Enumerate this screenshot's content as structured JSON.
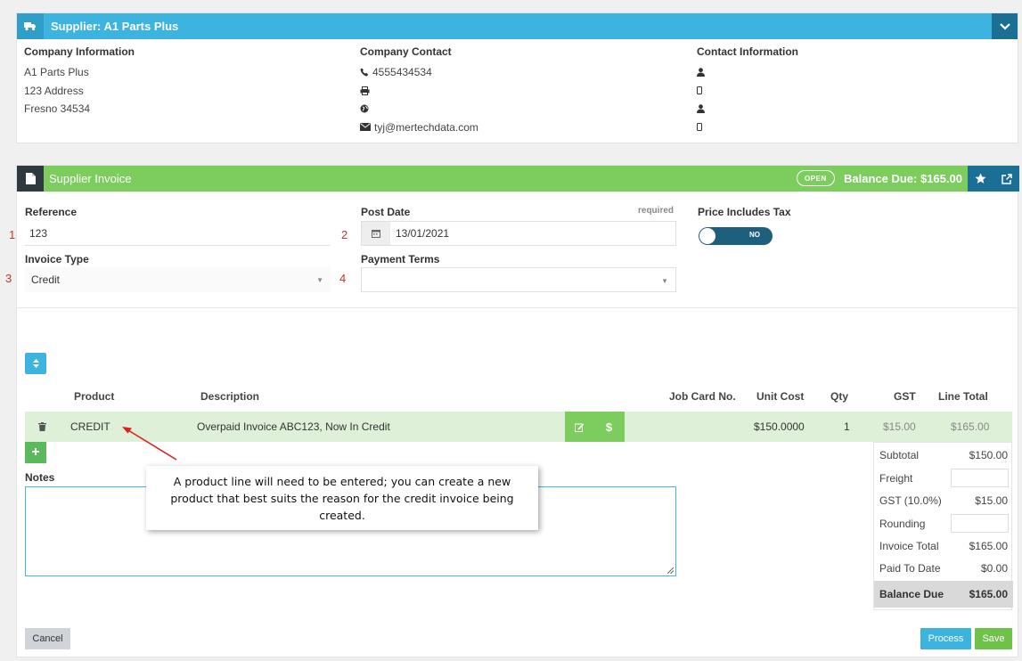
{
  "supplier": {
    "title": "Supplier: A1 Parts Plus",
    "company_info": {
      "heading": "Company Information",
      "lines": [
        "A1 Parts Plus",
        "123 Address",
        "Fresno 34534"
      ]
    },
    "company_contact": {
      "heading": "Company Contact",
      "phone": "4555434534",
      "fax": "",
      "web": "",
      "email": "tyj@mertechdata.com"
    },
    "contact_info": {
      "heading": "Contact Information"
    }
  },
  "invoice": {
    "title": "Supplier Invoice",
    "status_badge": "OPEN",
    "balance_due_header": "Balance Due: $165.00",
    "fields": {
      "reference_label": "Reference",
      "reference_value": "123",
      "post_date_label": "Post Date",
      "post_date_required": "required",
      "post_date_value": "13/01/2021",
      "price_tax_label": "Price Includes Tax",
      "price_tax_toggle": "NO",
      "invoice_type_label": "Invoice Type",
      "invoice_type_value": "Credit",
      "payment_terms_label": "Payment Terms",
      "payment_terms_value": ""
    },
    "annotations": [
      "1",
      "2",
      "3",
      "4"
    ],
    "table": {
      "headers": [
        "Product",
        "Description",
        "Job Card No.",
        "Unit Cost",
        "Qty",
        "GST",
        "Line Total"
      ],
      "rows": [
        {
          "product": "CREDIT",
          "description": "Overpaid Invoice ABC123, Now In Credit",
          "job_card": "",
          "unit_cost": "$150.0000",
          "qty": "1",
          "gst": "$15.00",
          "line_total": "$165.00"
        }
      ]
    },
    "notes_label": "Notes",
    "tooltip": "A product line will need to be entered; you can create a new product that best suits the reason for the credit invoice being created.",
    "totals": {
      "subtotal_label": "Subtotal",
      "subtotal": "$150.00",
      "freight_label": "Freight",
      "gst_label": "GST (10.0%)",
      "gst": "$15.00",
      "rounding_label": "Rounding",
      "invoice_total_label": "Invoice Total",
      "invoice_total": "$165.00",
      "paid_label": "Paid To Date",
      "paid": "$0.00",
      "balance_label": "Balance Due",
      "balance": "$165.00"
    },
    "buttons": {
      "cancel": "Cancel",
      "process": "Process",
      "save": "Save"
    }
  },
  "colors": {
    "supplier_header": "#3db4e0",
    "invoice_header": "#7dcd5e",
    "dark_btn": "#1b6f95"
  }
}
